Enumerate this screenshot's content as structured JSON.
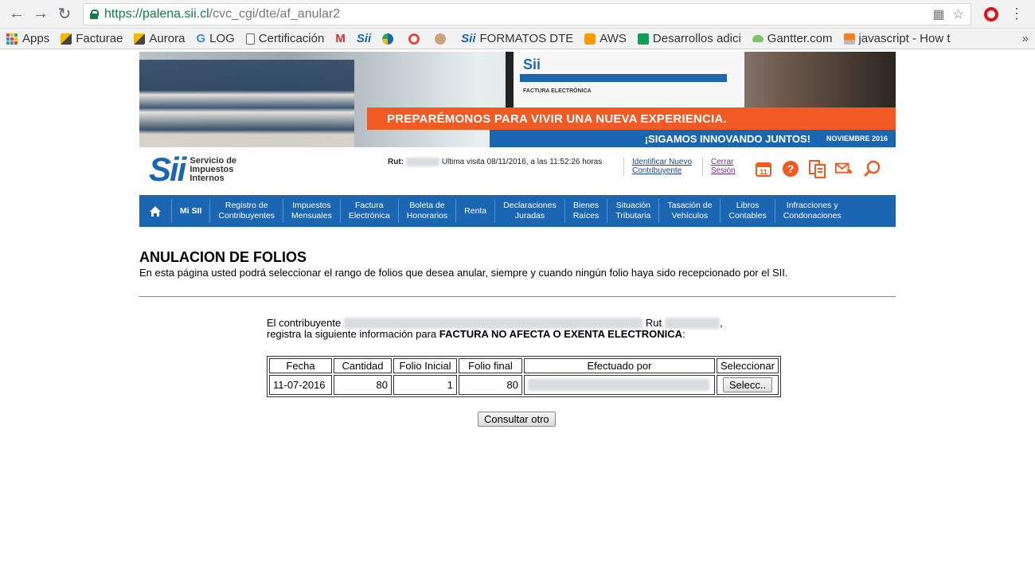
{
  "browser": {
    "url_host": "https://palena.sii.cl",
    "url_path": "/cvc_cgi/dte/af_anular2",
    "bookmarks": [
      "Apps",
      "Facturae",
      "Aurora",
      "LOG",
      "Certificación",
      "",
      "",
      "",
      "",
      "",
      "FORMATOS DTE",
      "AWS",
      "Desarrollos adici",
      "Gantter.com",
      "javascript - How t"
    ],
    "more": "»"
  },
  "banner": {
    "headline": "PREPARÉMONOS PARA VIVIR UNA NUEVA EXPERIENCIA.",
    "tagline": "¡SIGAMOS INNOVANDO JUNTOS!",
    "date": "NOVIEMBRE 2016",
    "screen_title": "FACTURA ELECTRÓNICA",
    "screen_logo": "Sii"
  },
  "header": {
    "logo_mark": "Sii",
    "logo_line1": "Servicio de",
    "logo_line2": "Impuestos",
    "logo_line3": "Internos",
    "rut_label": "Rut:",
    "rut_value": "",
    "last_visit": "Ultima visita 08/11/2016, a las 11:52:26 horas",
    "link_identify_1": "Identificar Nuevo",
    "link_identify_2": "Contribuyente",
    "link_logout_1": "Cerrar",
    "link_logout_2": "Sesión"
  },
  "menu": [
    "Mi SII",
    "Registro de\nContribuyentes",
    "Impuestos\nMensuales",
    "Factura\nElectrónica",
    "Boleta de\nHonorarios",
    "Renta",
    "Declaraciones\nJuradas",
    "Bienes\nRaíces",
    "Situación\nTributaria",
    "Tasación de\nVehículos",
    "Libros\nContables",
    "Infracciones y\nCondonaciones"
  ],
  "main": {
    "title": "ANULACION DE FOLIOS",
    "description": "En esta página usted podrá seleccionar el rango de folios que desea anular, siempre y cuando ningún folio haya sido recepcionado por el SII.",
    "contrib_prefix": "El contribuyente",
    "contrib_rut_label": "Rut",
    "contrib_suffix": ",",
    "line2_prefix": "registra la siguiente información para",
    "doc_type": "FACTURA NO AFECTA O EXENTA ELECTRONICA",
    "line2_suffix": ":",
    "table": {
      "headers": [
        "Fecha",
        "Cantidad",
        "Folio Inicial",
        "Folio final",
        "Efectuado por",
        "Seleccionar"
      ],
      "rows": [
        {
          "fecha": "11-07-2016",
          "cantidad": "80",
          "folio_inicial": "1",
          "folio_final": "80",
          "efectuado_por": "",
          "action": "Selecc.."
        }
      ]
    },
    "consultar_label": "Consultar otro"
  },
  "colors": {
    "sii_blue": "#1b66b3",
    "banner_orange": "#f15a22"
  }
}
